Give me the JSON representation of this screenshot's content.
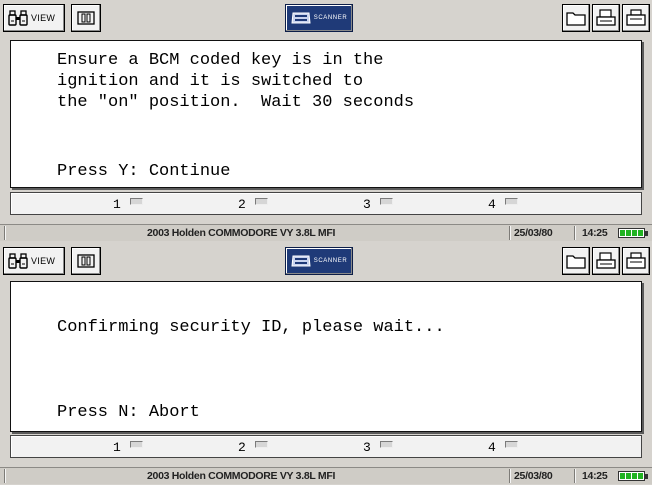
{
  "screens": [
    {
      "toolbar": {
        "view_label": "VIEW",
        "scanner_label": "SCANNER"
      },
      "message_lines": [
        "Ensure a BCM coded key is in the",
        "ignition and it is switched to",
        "the \"on\" position.  Wait 30 seconds",
        "",
        "",
        "Press Y: Continue"
      ],
      "function_keys": [
        "1",
        "2",
        "3",
        "4"
      ],
      "status": {
        "vehicle": "2003 Holden COMMODORE VY 3.8L MFI",
        "date": "25/03/80",
        "time": "14:25"
      }
    },
    {
      "toolbar": {
        "view_label": "VIEW",
        "scanner_label": "SCANNER"
      },
      "message_lines": [
        "",
        "Confirming security ID, please wait...",
        "",
        "",
        "Press N: Abort"
      ],
      "function_keys": [
        "1",
        "2",
        "3",
        "4"
      ],
      "status": {
        "vehicle": "2003 Holden COMMODORE VY 3.8L MFI",
        "date": "25/03/80",
        "time": "14:25"
      }
    }
  ],
  "icons": {
    "view": "binoculars-icon",
    "pause": "pause-icon",
    "scanner": "scanner-icon",
    "folder": "folder-icon",
    "print": "printer-icon",
    "battery": "battery-icon"
  },
  "colors": {
    "scanner_button": "#1f3a78",
    "battery_level": "#21b321",
    "background": "#d6d3ce"
  }
}
